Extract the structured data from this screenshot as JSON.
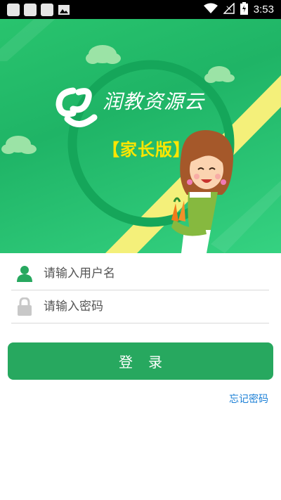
{
  "status_bar": {
    "time": "3:53",
    "icons": [
      "notification-icon",
      "notification-icon",
      "notification-icon",
      "image-icon",
      "wifi-icon",
      "no-signal-icon",
      "battery-charging-icon"
    ]
  },
  "hero": {
    "app_title": "润教资源云",
    "edition": "【家长版】"
  },
  "form": {
    "username_placeholder": "请输入用户名",
    "password_placeholder": "请输入密码",
    "username_value": "",
    "password_value": "",
    "login_label": "登录",
    "forgot_password": "忘记密码"
  },
  "colors": {
    "brand_green": "#27a85f",
    "hero_green": "#29c46e",
    "stripe_yellow": "#f4f07a",
    "link_blue": "#1a7fd6"
  }
}
